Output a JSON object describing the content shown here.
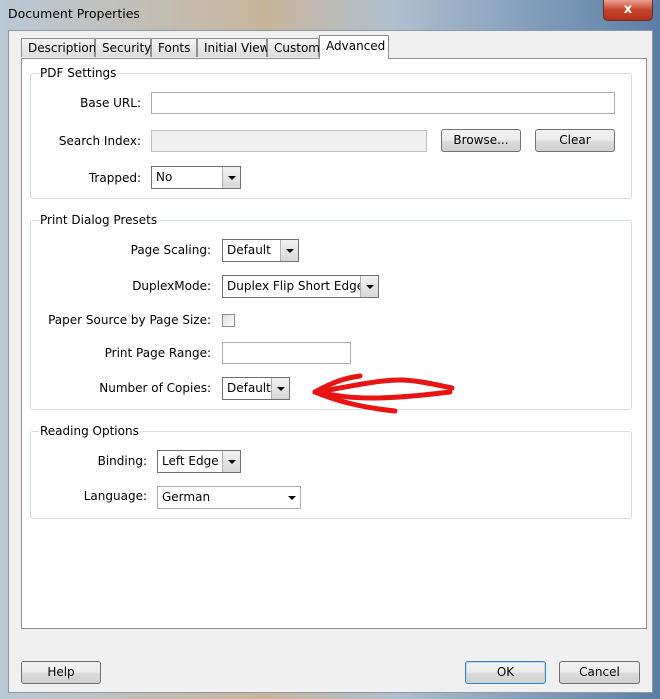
{
  "window": {
    "title": "Document Properties",
    "close_glyph": "x"
  },
  "tabs": [
    {
      "label": "Description"
    },
    {
      "label": "Security"
    },
    {
      "label": "Fonts"
    },
    {
      "label": "Initial View"
    },
    {
      "label": "Custom"
    },
    {
      "label": "Advanced",
      "active": true
    }
  ],
  "pdf_settings": {
    "title": "PDF Settings",
    "base_url_label": "Base URL:",
    "base_url_value": "",
    "search_index_label": "Search Index:",
    "search_index_value": "",
    "browse_label": "Browse...",
    "clear_label": "Clear",
    "trapped_label": "Trapped:",
    "trapped_value": "No"
  },
  "print_presets": {
    "title": "Print Dialog Presets",
    "page_scaling_label": "Page Scaling:",
    "page_scaling_value": "Default",
    "duplex_label": "DuplexMode:",
    "duplex_value": "Duplex Flip Short Edge",
    "paper_source_label": "Paper Source by Page Size:",
    "paper_source_checked": false,
    "page_range_label": "Print Page Range:",
    "page_range_value": "",
    "copies_label": "Number of Copies:",
    "copies_value": "Default"
  },
  "reading_options": {
    "title": "Reading Options",
    "binding_label": "Binding:",
    "binding_value": "Left Edge",
    "language_label": "Language:",
    "language_value": "German"
  },
  "footer": {
    "help_label": "Help",
    "ok_label": "OK",
    "cancel_label": "Cancel"
  },
  "annotation": {
    "color": "#e81414",
    "icon": "hand-drawn-arrow-icon"
  }
}
